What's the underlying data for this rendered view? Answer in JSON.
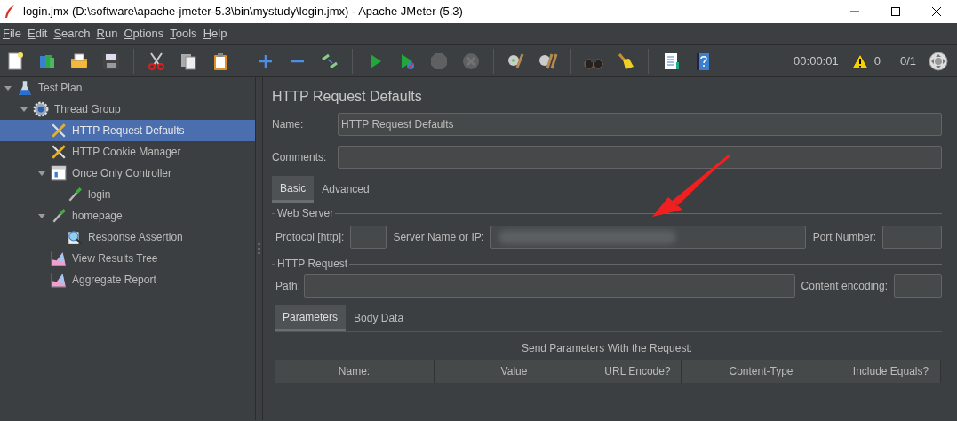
{
  "window": {
    "title": "login.jmx (D:\\software\\apache-jmeter-5.3\\bin\\mystudy\\login.jmx) - Apache JMeter (5.3)"
  },
  "menu": [
    "File",
    "Edit",
    "Search",
    "Run",
    "Options",
    "Tools",
    "Help"
  ],
  "toolbar_status": {
    "elapsed": "00:00:01",
    "error_count": "0",
    "threads": "0/1"
  },
  "tree": [
    {
      "label": "Test Plan",
      "kind": "plan",
      "expanded": true,
      "selected": false,
      "children": [
        {
          "label": "Thread Group",
          "kind": "threads",
          "expanded": true,
          "selected": false,
          "children": [
            {
              "label": "HTTP Request Defaults",
              "kind": "config",
              "selected": true
            },
            {
              "label": "HTTP Cookie Manager",
              "kind": "config",
              "selected": false
            },
            {
              "label": "Once Only Controller",
              "kind": "controller",
              "expanded": true,
              "selected": false,
              "children": [
                {
                  "label": "login",
                  "kind": "sampler",
                  "selected": false
                }
              ]
            },
            {
              "label": "homepage",
              "kind": "sampler",
              "expanded": true,
              "selected": false,
              "children": [
                {
                  "label": "Response Assertion",
                  "kind": "assertion",
                  "selected": false
                }
              ]
            },
            {
              "label": "View Results Tree",
              "kind": "listener",
              "selected": false
            },
            {
              "label": "Aggregate Report",
              "kind": "listener",
              "selected": false
            }
          ]
        }
      ]
    }
  ],
  "panel": {
    "title": "HTTP Request Defaults",
    "name_label": "Name:",
    "name_value": "HTTP Request Defaults",
    "comments_label": "Comments:",
    "tabs": [
      {
        "label": "Basic",
        "selected": true
      },
      {
        "label": "Advanced",
        "selected": false
      }
    ],
    "web_server": {
      "title": "Web Server",
      "protocol_label": "Protocol [http]:",
      "server_label": "Server Name or IP:",
      "server_redacted": true,
      "port_label": "Port Number:"
    },
    "http_request": {
      "title": "HTTP Request",
      "path_label": "Path:",
      "encoding_label": "Content encoding:"
    },
    "sub_tabs": [
      {
        "label": "Parameters",
        "selected": true
      },
      {
        "label": "Body Data",
        "selected": false
      }
    ],
    "params_caption": "Send Parameters With the Request:",
    "columns": [
      "Name:",
      "Value",
      "URL Encode?",
      "Content-Type",
      "Include Equals?"
    ]
  }
}
